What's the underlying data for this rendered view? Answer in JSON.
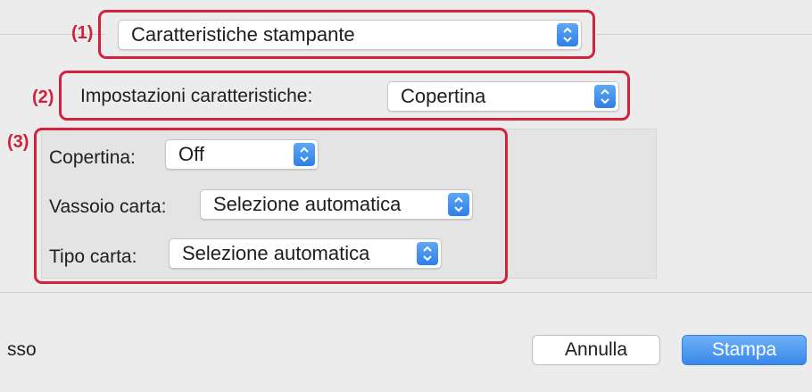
{
  "callouts": {
    "c1": "(1)",
    "c2": "(2)",
    "c3": "(3)"
  },
  "section_popup": {
    "value": "Caratteristiche stampante"
  },
  "feature_settings": {
    "label": "Impostazioni caratteristiche:",
    "value": "Copertina"
  },
  "options": {
    "cover": {
      "label": "Copertina:",
      "value": "Off"
    },
    "paper_tray": {
      "label": "Vassoio carta:",
      "value": "Selezione automatica"
    },
    "paper_type": {
      "label": "Tipo carta:",
      "value": "Selezione automatica"
    }
  },
  "footer": {
    "left_text": "sso",
    "cancel_label": "Annulla",
    "print_label": "Stampa"
  },
  "colors": {
    "highlight": "#d4213d",
    "accent": "#3a87ea",
    "background": "#ececec"
  }
}
